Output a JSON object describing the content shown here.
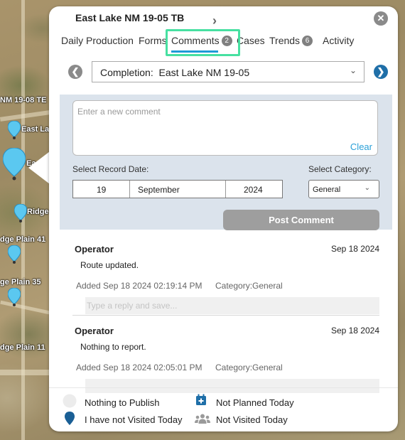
{
  "map": {
    "labels": [
      "NM 19-08 TE",
      "East La",
      "Ea",
      "Ridge",
      "dge Plain 41",
      "ge Plain 35",
      "dge Plain 11"
    ]
  },
  "popup": {
    "title": "East Lake NM 19-05 TB",
    "tabs": [
      {
        "label": "Daily Production"
      },
      {
        "label": "Forms"
      },
      {
        "label": "Comments",
        "badge": "2"
      },
      {
        "label": "Cases"
      },
      {
        "label": "Trends",
        "badge": "6"
      },
      {
        "label": "Activity"
      }
    ],
    "completion_select": {
      "label": "Completion:",
      "value": "East Lake NM 19-05"
    },
    "comment_input": {
      "placeholder": "Enter a new comment",
      "clear_label": "Clear"
    },
    "record_date_label": "Select Record Date:",
    "record_date": {
      "day": "19",
      "month": "September",
      "year": "2024"
    },
    "category_label": "Select Category:",
    "category_value": "General",
    "post_button": "Post Comment",
    "comments": [
      {
        "author": "Operator",
        "date": "Sep 18 2024",
        "text": "Route updated.",
        "added": "Added Sep 18 2024 02:19:14 PM",
        "category": "Category:General",
        "reply_placeholder": "Type a reply and save..."
      },
      {
        "author": "Operator",
        "date": "Sep 18 2024",
        "text": "Nothing to report.",
        "added": "Added Sep 18 2024 02:05:01 PM",
        "category": "Category:General",
        "reply_placeholder": "Type a reply and save..."
      }
    ],
    "legend": [
      {
        "icon": "circle-icon",
        "label": "Nothing to Publish"
      },
      {
        "icon": "calendar-plus-icon",
        "label": "Not Planned Today"
      },
      {
        "icon": "map-pin-icon",
        "label": "I have not Visited Today"
      },
      {
        "icon": "users-icon",
        "label": "Not Visited Today"
      }
    ]
  },
  "colors": {
    "accent": "#1f9bd7",
    "highlight": "#47e0a1",
    "form_bg": "#dbe3ec",
    "pin_light": "#5bc8f0",
    "pin_dark": "#1a5f95",
    "nav_dark": "#1f6fa8"
  }
}
